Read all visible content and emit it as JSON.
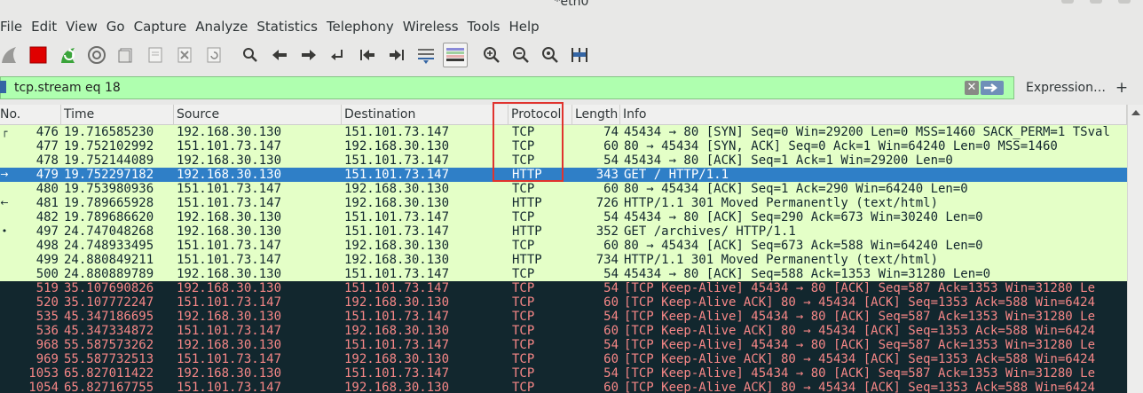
{
  "window": {
    "title": "*eth0"
  },
  "menu": [
    "File",
    "Edit",
    "View",
    "Go",
    "Capture",
    "Analyze",
    "Statistics",
    "Telephony",
    "Wireless",
    "Tools",
    "Help"
  ],
  "toolbar": {
    "icons": [
      "shark-fin-start-icon",
      "stop-capture-icon",
      "restart-capture-icon",
      "capture-options-icon",
      "open-file-icon",
      "save-file-icon",
      "close-file-icon",
      "reload-file-icon",
      "find-packet-icon",
      "go-back-icon",
      "go-forward-icon",
      "go-to-packet-icon",
      "go-first-icon",
      "go-last-icon",
      "autoscroll-icon",
      "colorize-icon",
      "zoom-in-icon",
      "zoom-out-icon",
      "normal-size-icon",
      "resize-columns-icon"
    ]
  },
  "filter": {
    "value": "tcp.stream eq 18",
    "expression_label": "Expression…",
    "add_label": "+",
    "clear_label": "✕"
  },
  "columns": [
    "No.",
    "Time",
    "Source",
    "Destination",
    "Protocol",
    "Length",
    "Info"
  ],
  "colors": {
    "tcp_row": "#e7e6ff",
    "http_row": "#e4ffc7",
    "selected_row": "#2f7fc7",
    "bad_row_bg": "#12272e",
    "bad_row_fg": "#f78787",
    "highlight": "#e0332e",
    "filter_bg": "#afffaf"
  },
  "packets": [
    {
      "marker": "┌",
      "no": "476",
      "time": "19.716585230",
      "src": "192.168.30.130",
      "dst": "151.101.73.147",
      "proto": "TCP",
      "len": "74",
      "info": "45434 → 80 [SYN] Seq=0 Win=29200 Len=0 MSS=1460 SACK_PERM=1 TSval",
      "style": "http"
    },
    {
      "marker": "",
      "no": "477",
      "time": "19.752102992",
      "src": "151.101.73.147",
      "dst": "192.168.30.130",
      "proto": "TCP",
      "len": "60",
      "info": "80 → 45434 [SYN, ACK] Seq=0 Ack=1 Win=64240 Len=0 MSS=1460",
      "style": "http"
    },
    {
      "marker": "",
      "no": "478",
      "time": "19.752144089",
      "src": "192.168.30.130",
      "dst": "151.101.73.147",
      "proto": "TCP",
      "len": "54",
      "info": "45434 → 80 [ACK] Seq=1 Ack=1 Win=29200 Len=0",
      "style": "http"
    },
    {
      "marker": "→",
      "no": "479",
      "time": "19.752297182",
      "src": "192.168.30.130",
      "dst": "151.101.73.147",
      "proto": "HTTP",
      "len": "343",
      "info": "GET / HTTP/1.1",
      "style": "selected"
    },
    {
      "marker": "",
      "no": "480",
      "time": "19.753980936",
      "src": "151.101.73.147",
      "dst": "192.168.30.130",
      "proto": "TCP",
      "len": "60",
      "info": "80 → 45434 [ACK] Seq=1 Ack=290 Win=64240 Len=0",
      "style": "http"
    },
    {
      "marker": "←",
      "no": "481",
      "time": "19.789665928",
      "src": "151.101.73.147",
      "dst": "192.168.30.130",
      "proto": "HTTP",
      "len": "726",
      "info": "HTTP/1.1 301 Moved Permanently  (text/html)",
      "style": "http"
    },
    {
      "marker": "",
      "no": "482",
      "time": "19.789686620",
      "src": "192.168.30.130",
      "dst": "151.101.73.147",
      "proto": "TCP",
      "len": "54",
      "info": "45434 → 80 [ACK] Seq=290 Ack=673 Win=30240 Len=0",
      "style": "http"
    },
    {
      "marker": "•",
      "no": "497",
      "time": "24.747048268",
      "src": "192.168.30.130",
      "dst": "151.101.73.147",
      "proto": "HTTP",
      "len": "352",
      "info": "GET /archives/ HTTP/1.1",
      "style": "http"
    },
    {
      "marker": "",
      "no": "498",
      "time": "24.748933495",
      "src": "151.101.73.147",
      "dst": "192.168.30.130",
      "proto": "TCP",
      "len": "60",
      "info": "80 → 45434 [ACK] Seq=673 Ack=588 Win=64240 Len=0",
      "style": "http"
    },
    {
      "marker": "",
      "no": "499",
      "time": "24.880849211",
      "src": "151.101.73.147",
      "dst": "192.168.30.130",
      "proto": "HTTP",
      "len": "734",
      "info": "HTTP/1.1 301 Moved Permanently  (text/html)",
      "style": "http"
    },
    {
      "marker": "",
      "no": "500",
      "time": "24.880889789",
      "src": "192.168.30.130",
      "dst": "151.101.73.147",
      "proto": "TCP",
      "len": "54",
      "info": "45434 → 80 [ACK] Seq=588 Ack=1353 Win=31280 Len=0",
      "style": "http"
    },
    {
      "marker": "",
      "no": "519",
      "time": "35.107690826",
      "src": "192.168.30.130",
      "dst": "151.101.73.147",
      "proto": "TCP",
      "len": "54",
      "info": "[TCP Keep-Alive] 45434 → 80 [ACK] Seq=587 Ack=1353 Win=31280 Le",
      "style": "bad"
    },
    {
      "marker": "",
      "no": "520",
      "time": "35.107772247",
      "src": "151.101.73.147",
      "dst": "192.168.30.130",
      "proto": "TCP",
      "len": "60",
      "info": "[TCP Keep-Alive ACK] 80 → 45434 [ACK] Seq=1353 Ack=588 Win=6424",
      "style": "bad"
    },
    {
      "marker": "",
      "no": "535",
      "time": "45.347186695",
      "src": "192.168.30.130",
      "dst": "151.101.73.147",
      "proto": "TCP",
      "len": "54",
      "info": "[TCP Keep-Alive] 45434 → 80 [ACK] Seq=587 Ack=1353 Win=31280 Le",
      "style": "bad"
    },
    {
      "marker": "",
      "no": "536",
      "time": "45.347334872",
      "src": "151.101.73.147",
      "dst": "192.168.30.130",
      "proto": "TCP",
      "len": "60",
      "info": "[TCP Keep-Alive ACK] 80 → 45434 [ACK] Seq=1353 Ack=588 Win=6424",
      "style": "bad"
    },
    {
      "marker": "",
      "no": "968",
      "time": "55.587573262",
      "src": "192.168.30.130",
      "dst": "151.101.73.147",
      "proto": "TCP",
      "len": "54",
      "info": "[TCP Keep-Alive] 45434 → 80 [ACK] Seq=587 Ack=1353 Win=31280 Le",
      "style": "bad"
    },
    {
      "marker": "",
      "no": "969",
      "time": "55.587732513",
      "src": "151.101.73.147",
      "dst": "192.168.30.130",
      "proto": "TCP",
      "len": "60",
      "info": "[TCP Keep-Alive ACK] 80 → 45434 [ACK] Seq=1353 Ack=588 Win=6424",
      "style": "bad"
    },
    {
      "marker": "",
      "no": "1053",
      "time": "65.827011422",
      "src": "192.168.30.130",
      "dst": "151.101.73.147",
      "proto": "TCP",
      "len": "54",
      "info": "[TCP Keep-Alive] 45434 → 80 [ACK] Seq=587 Ack=1353 Win=31280 Le",
      "style": "bad"
    },
    {
      "marker": "",
      "no": "1054",
      "time": "65.827167755",
      "src": "151.101.73.147",
      "dst": "192.168.30.130",
      "proto": "TCP",
      "len": "60",
      "info": "[TCP Keep-Alive ACK] 80 → 45434 [ACK] Seq=1353 Ack=588 Win=6424",
      "style": "bad"
    }
  ]
}
